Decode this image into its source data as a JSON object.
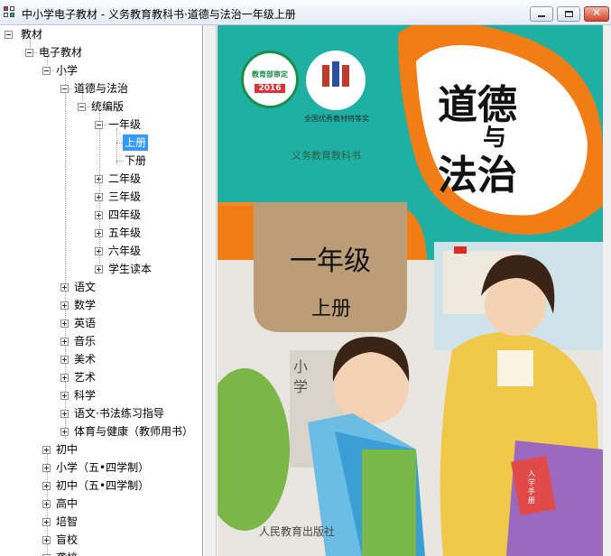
{
  "window": {
    "title": "中小学电子教材 - 义务教育教科书·道德与法治一年级上册",
    "buttons": [
      "minimize",
      "maximize",
      "close"
    ]
  },
  "tree": {
    "nodes": [
      {
        "label": "教材",
        "selected": false
      },
      {
        "label": "电子教材",
        "selected": false
      },
      {
        "label": "小学",
        "selected": false
      },
      {
        "label": "道德与法治",
        "selected": false
      },
      {
        "label": "统编版",
        "selected": false
      },
      {
        "label": "一年级",
        "selected": false
      },
      {
        "label": "上册",
        "selected": true
      },
      {
        "label": "下册",
        "selected": false
      },
      {
        "label": "二年级",
        "selected": false
      },
      {
        "label": "三年级",
        "selected": false
      },
      {
        "label": "四年级",
        "selected": false
      },
      {
        "label": "五年级",
        "selected": false
      },
      {
        "label": "六年级",
        "selected": false
      },
      {
        "label": "学生读本",
        "selected": false
      },
      {
        "label": "语文",
        "selected": false
      },
      {
        "label": "数学",
        "selected": false
      },
      {
        "label": "英语",
        "selected": false
      },
      {
        "label": "音乐",
        "selected": false
      },
      {
        "label": "美术",
        "selected": false
      },
      {
        "label": "艺术",
        "selected": false
      },
      {
        "label": "科学",
        "selected": false
      },
      {
        "label": "语文·书法练习指导",
        "selected": false
      },
      {
        "label": "体育与健康（教师用书）",
        "selected": false
      },
      {
        "label": "初中",
        "selected": false
      },
      {
        "label": "小学（五•四学制）",
        "selected": false
      },
      {
        "label": "初中（五•四学制）",
        "selected": false
      },
      {
        "label": "高中",
        "selected": false
      },
      {
        "label": "培智",
        "selected": false
      },
      {
        "label": "盲校",
        "selected": false
      },
      {
        "label": "聋校",
        "selected": false
      }
    ]
  },
  "cover": {
    "badge_top": "教育部审定",
    "badge_year": "2016",
    "award": "全国优秀教材特等奖",
    "series": "义务教育教科书",
    "title_top": "道德",
    "title_mid": "与",
    "title_bottom": "法治",
    "grade": "一年级",
    "volume": "上册",
    "school_sign": "小学",
    "book_label": "入学手册",
    "publisher": "人民教育出版社",
    "colors": {
      "teal": "#1fb0a3",
      "orange": "#f07d16",
      "tan": "#bd9c78"
    }
  }
}
